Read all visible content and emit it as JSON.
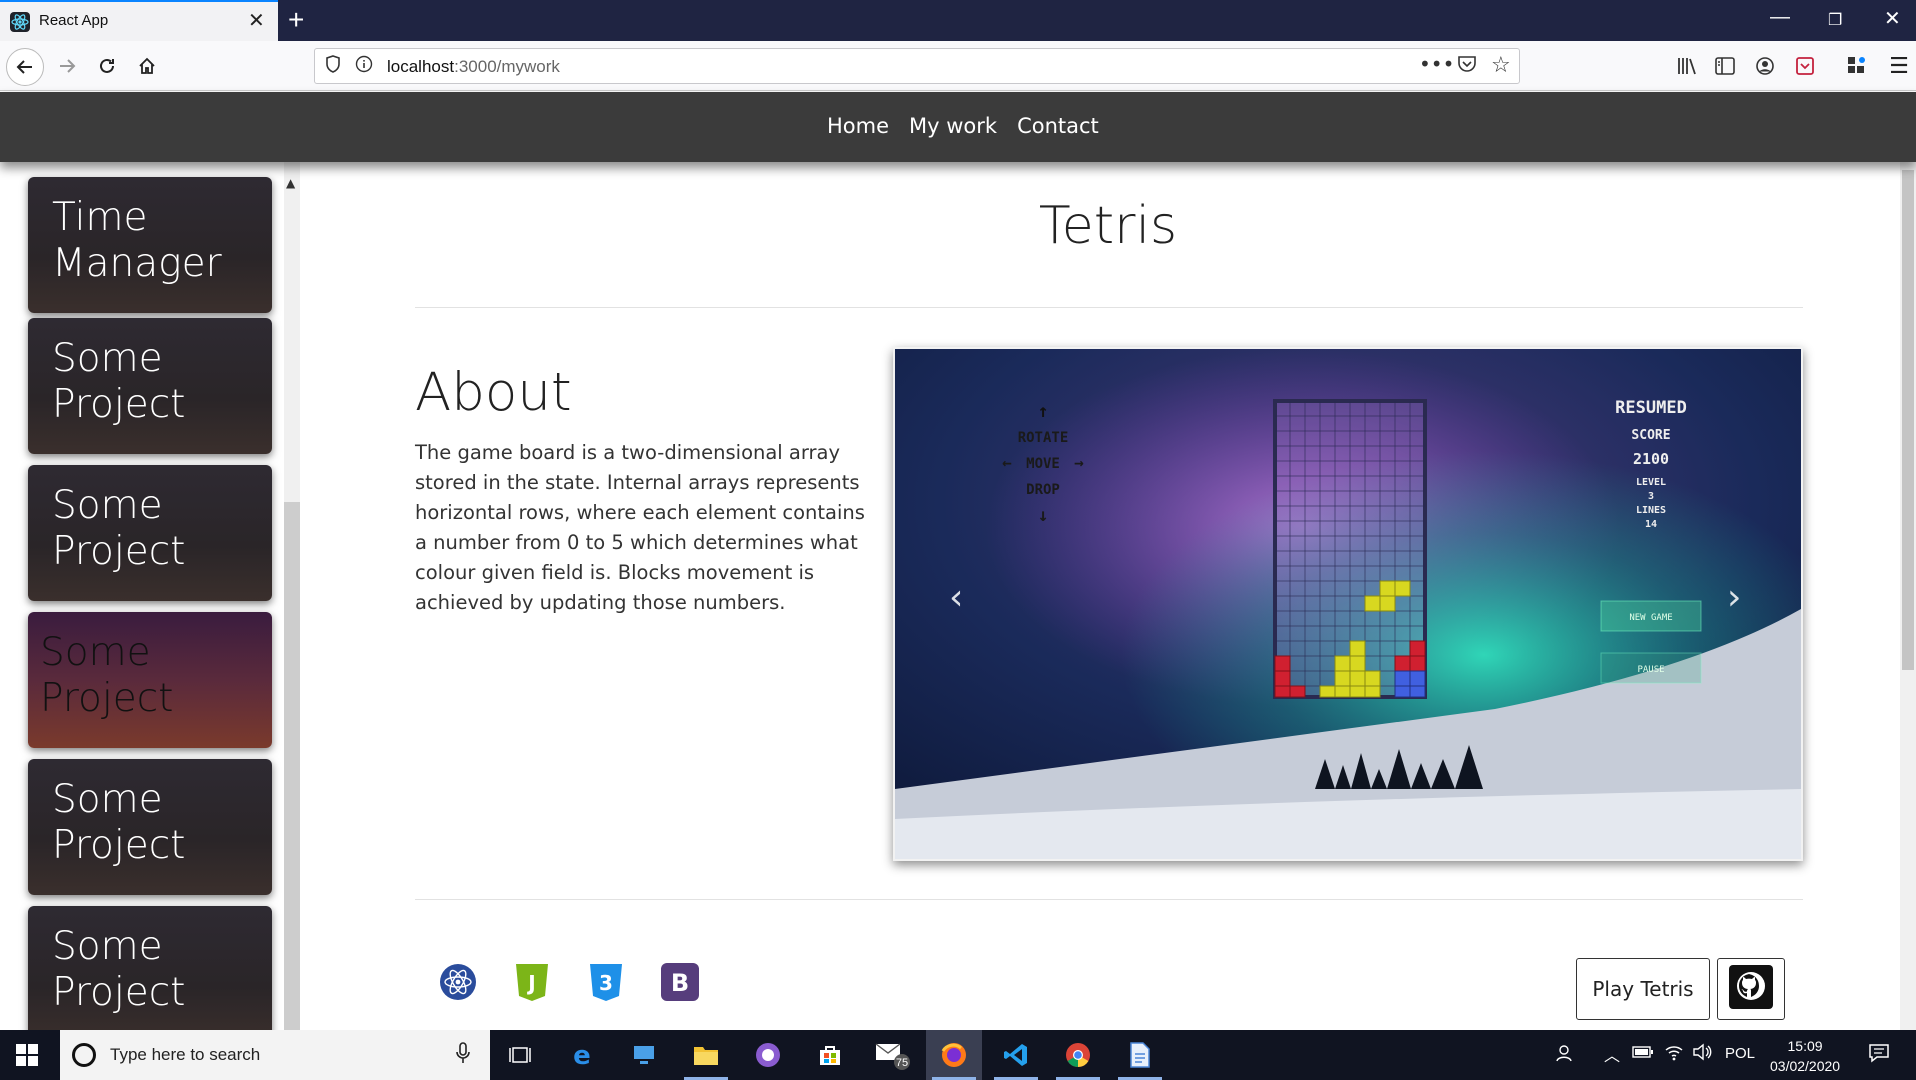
{
  "browser": {
    "tab_title": "React App",
    "url_host": "localhost",
    "url_path": ":3000/mywork"
  },
  "site_nav": {
    "links": [
      "Home",
      "My work",
      "Contact"
    ]
  },
  "sidebar": {
    "cards": [
      {
        "label": "Time Manager"
      },
      {
        "label": "Some Project"
      },
      {
        "label": "Some Project"
      },
      {
        "label": "Some Project",
        "active": true
      },
      {
        "label": "Some Project"
      },
      {
        "label": "Some Project"
      }
    ]
  },
  "project": {
    "title": "Tetris",
    "about_heading": "About",
    "about_text": "The game board is a two-dimensional array stored in the state. Internal arrays represents horizontal rows, where each element contains a number from 0 to 5 which determines what colour given field is. Blocks movement is achieved by updating those numbers.",
    "screenshot": {
      "controls": [
        "ROTATE",
        "MOVE",
        "DROP"
      ],
      "status": "RESUMED",
      "score_label": "SCORE",
      "score": "2100",
      "level_label": "LEVEL",
      "level": "3",
      "lines_label": "LINES",
      "lines": "14",
      "new_game_label": "NEW GAME",
      "pause_label": "PAUSE"
    },
    "tech_icons": [
      "react-icon",
      "javascript-icon",
      "css3-icon",
      "bootstrap-icon"
    ],
    "play_label": "Play Tetris"
  },
  "taskbar": {
    "search_placeholder": "Type here to search",
    "mail_badge": "75",
    "language": "POL",
    "time": "15:09",
    "date": "03/02/2020"
  },
  "colors": {
    "tab_bar": "#1f2442",
    "site_nav": "#3b3b3b",
    "taskbar": "#101421"
  }
}
